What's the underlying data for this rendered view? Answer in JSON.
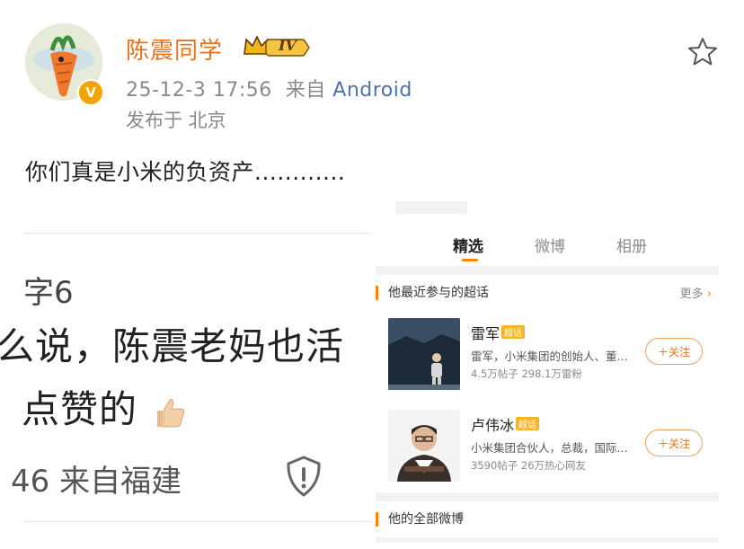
{
  "post": {
    "username": "陈震同学",
    "level_badge": "IV",
    "timestamp": "25-12-3 17:56",
    "from_prefix": "来自",
    "source": "Android",
    "location": "发布于 北京",
    "text": "你们真是小米的负资产............",
    "icons": {
      "verified": "verified-v-icon",
      "favorite": "star-outline-icon",
      "crown": "crown-icon"
    }
  },
  "left_screenshot": {
    "line1": "字6",
    "line2": "么说，陈震老妈也活",
    "line3": "点赞的",
    "footer": "46 来自福建",
    "icons": {
      "thumb": "thumbs-up-emoji",
      "report": "shield-alert-icon"
    }
  },
  "right_screenshot": {
    "tabs": [
      "精选",
      "微博",
      "相册"
    ],
    "active_tab": "精选",
    "topics_section": {
      "title": "他最近参与的超话",
      "more": "更多"
    },
    "topics": [
      {
        "name": "雷军",
        "tag": "超话",
        "desc": "雷军，小米集团的创始人、董...",
        "stats": "4.5万帖子 298.1万雷粉",
        "follow": "＋关注"
      },
      {
        "name": "卢伟冰",
        "tag": "超话",
        "desc": "小米集团合伙人，总裁，国际...",
        "stats": "3590帖子 26万热心网友",
        "follow": "＋关注"
      }
    ],
    "all_posts_title": "他的全部微博"
  },
  "colors": {
    "accent": "#ff8200",
    "username": "#e8711a",
    "link": "#4e73a8",
    "muted": "#8a8a8a"
  }
}
